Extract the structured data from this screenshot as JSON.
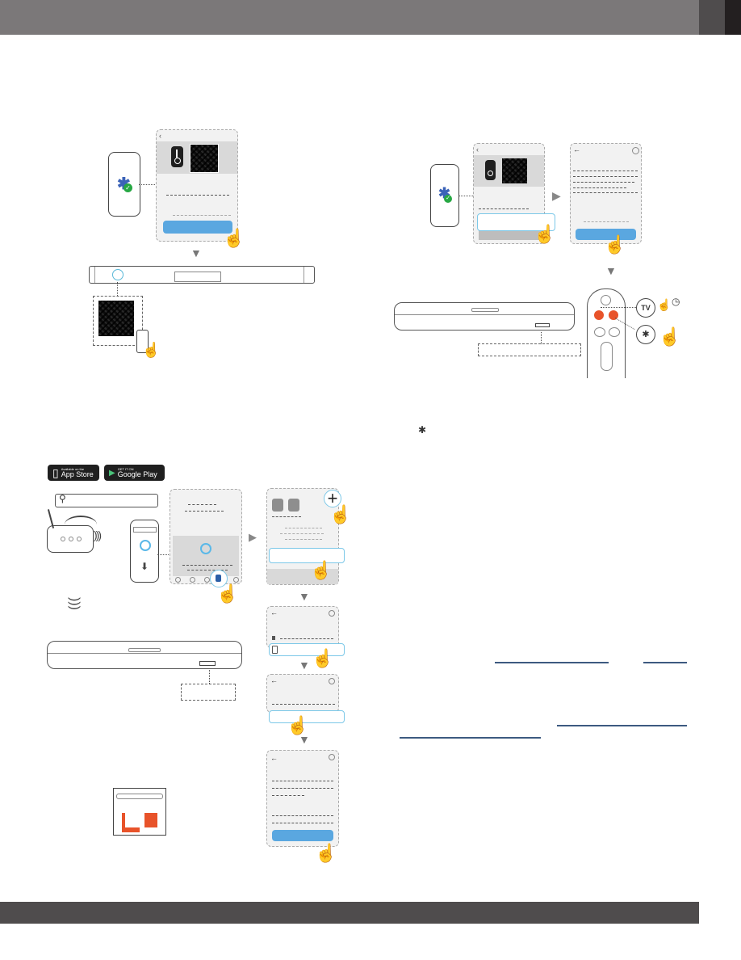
{
  "page": {
    "header": {
      "tab_label": "",
      "title": ""
    },
    "footer": {
      "text": ""
    }
  },
  "colors": {
    "header_bar": "#7b7879",
    "header_tab": "#4f4c4d",
    "header_edge": "#231f20",
    "footer_bar": "#4f4c4d",
    "accent_blue": "#5aa7e0",
    "highlight_outline": "#7cc8e8",
    "remote_button": "#e8532a",
    "link": "#3d5a80",
    "bluetooth_green": "#27a844",
    "bluetooth_blue": "#3b63b8"
  },
  "icons": {
    "bluetooth": "✱",
    "check": "✓",
    "arrow_down": "▼",
    "arrow_right": "▶",
    "hand": "☝",
    "search": "⚲",
    "plus": "+",
    "back": "←",
    "chevron_left": "‹",
    "clock": "◷",
    "download": "⬇",
    "wifi": ")))"
  },
  "store_badges": {
    "app_store": {
      "small": "Available on the",
      "big": "App Store"
    },
    "google_play": {
      "small": "GET IT ON",
      "big": "Google Play"
    }
  },
  "remote": {
    "tv_label": "TV",
    "bt_label": "✱",
    "small_buttons": [
      "",
      ""
    ]
  },
  "links": [
    {
      "text": ""
    },
    {
      "text": ""
    },
    {
      "text": ""
    },
    {
      "text": ""
    }
  ]
}
